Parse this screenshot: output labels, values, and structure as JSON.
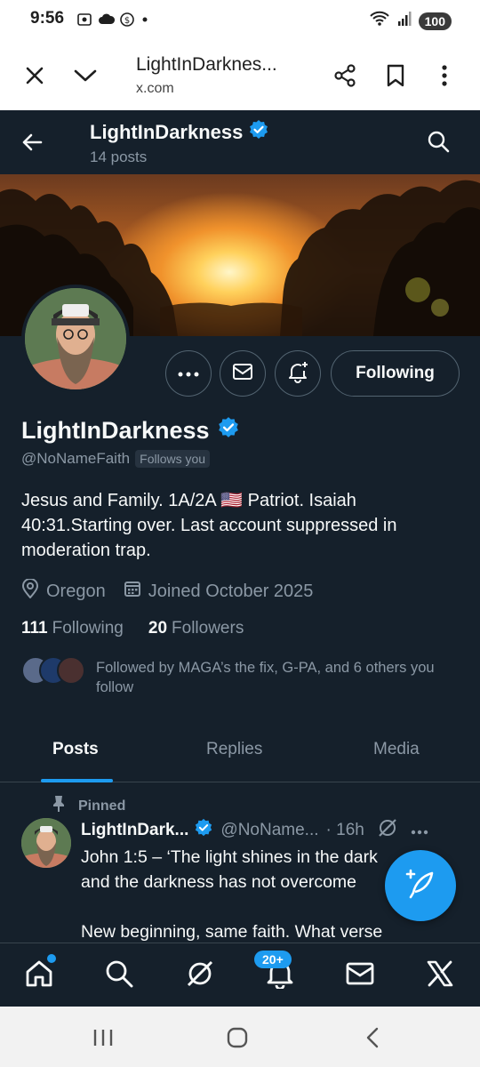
{
  "status_bar": {
    "time": "9:56",
    "battery": "100"
  },
  "browser": {
    "title": "LightInDarknes...",
    "url": "x.com"
  },
  "header": {
    "name": "LightInDarkness",
    "post_count": "14 posts"
  },
  "profile": {
    "display_name": "LightInDarkness",
    "handle": "@NoNameFaith",
    "follows_you": "Follows you",
    "bio": "Jesus and Family. 1A/2A 🇺🇸 Patriot. Isaiah 40:31.Starting over. Last account suppressed in moderation trap.",
    "location": "Oregon",
    "joined": "Joined October 2025",
    "following_count": "111",
    "following_label": "Following",
    "followers_count": "20",
    "followers_label": "Followers",
    "followed_by": "Followed by MAGA’s the fix, G-PA, and 6 others you follow",
    "follow_button": "Following"
  },
  "tabs": [
    {
      "label": "Posts",
      "active": true
    },
    {
      "label": "Replies",
      "active": false
    },
    {
      "label": "Media",
      "active": false
    }
  ],
  "pinned_post": {
    "pinned_label": "Pinned",
    "name": "LightInDark...",
    "handle": "@NoName...",
    "time": "· 16h",
    "text": "John 1:5 – ‘The light shines in the dark\nand the darkness has not overcome\n\nNew beginning, same faith. What verse"
  },
  "bottom_nav": {
    "notifications_badge": "20+"
  },
  "colors": {
    "background": "#15202b",
    "accent": "#1d9bf0",
    "muted": "#8b98a5",
    "border": "#38444d"
  }
}
